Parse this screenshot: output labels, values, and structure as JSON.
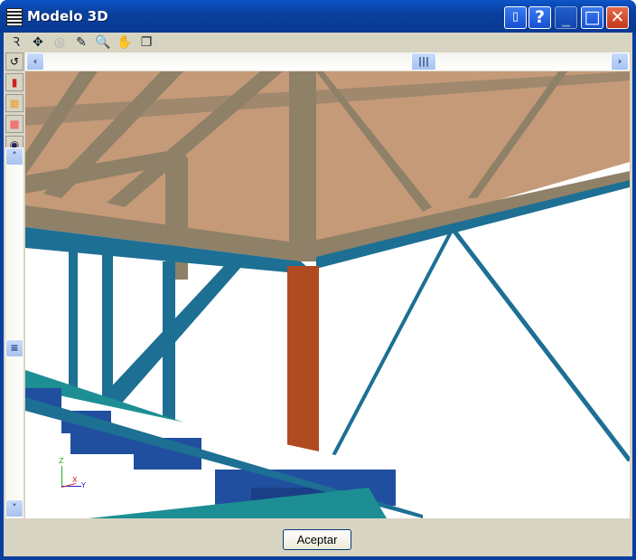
{
  "window": {
    "title": "Modelo 3D",
    "buttons": [
      "book-icon",
      "help",
      "minimize",
      "maximize",
      "close"
    ]
  },
  "toolbar": {
    "icons": [
      "rotate-view-icon",
      "zoom-all-icon",
      "zoom-previous-icon",
      "edit-icon",
      "zoom-window-icon",
      "pan-hand-icon",
      "copy-view-icon"
    ]
  },
  "left_toolbar": {
    "icons": [
      "undo-rotate-icon",
      "bar-chart-icon",
      "solid-box-icon",
      "rotate-box-icon",
      "view-eye-icon"
    ]
  },
  "axes": {
    "z": "Z",
    "x": "X",
    "y": "Y"
  },
  "footer": {
    "accept_label": "Aceptar"
  },
  "colors": {
    "roof": "#c59a78",
    "beam": "#8f8068",
    "steel": "#1d6f94",
    "column": "#b04a20",
    "base": "#1f4f9e"
  }
}
